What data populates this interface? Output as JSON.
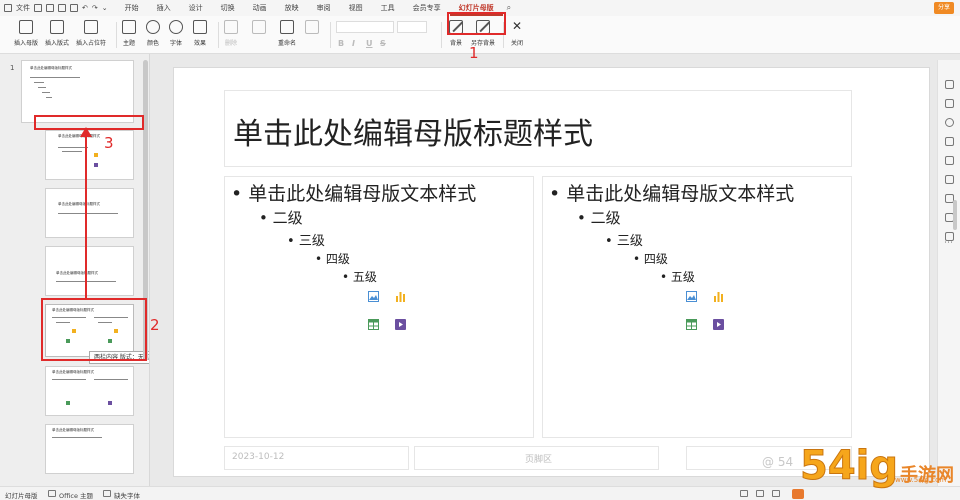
{
  "menubar": {
    "file": "文件",
    "start": "开始",
    "tabs": [
      "插入",
      "设计",
      "切换",
      "动画",
      "放映",
      "审阅",
      "视图",
      "工具",
      "会员专享",
      "幻灯片母版"
    ],
    "active_tab": "幻灯片母版",
    "share": "分享"
  },
  "ribbon": {
    "buttons": [
      "插入母版",
      "插入版式",
      "插入占位符",
      "主题",
      "颜色",
      "字体",
      "效果",
      "删除",
      "",
      "重命名",
      "",
      "",
      "背景",
      "另存背景",
      "关闭"
    ],
    "format_letters": [
      "B",
      "I",
      "U",
      "S"
    ]
  },
  "annotations": [
    "1",
    "2",
    "3"
  ],
  "thumbnails": {
    "first_number": "1",
    "titles": [
      "单击此处编辑母版标题样式",
      "单击此处编辑母版标题样式",
      "单击此处编辑母版标题样式",
      "单击此处编辑母版标题样式",
      "单击此处编辑母版标题样式",
      "单击此处编辑母版标题样式",
      "单击此处编辑母版标题样式"
    ],
    "tooltip": "两栏内容 版式：无幻灯片使用"
  },
  "slide": {
    "title": "单击此处编辑母版标题样式",
    "left": {
      "l1": "单击此处编辑母版文本样式",
      "l2": "二级",
      "l3": "三级",
      "l4": "四级",
      "l5": "五级"
    },
    "right": {
      "l1": "单击此处编辑母版文本样式",
      "l2": "二级",
      "l3": "三级",
      "l4": "四级",
      "l5": "五级"
    },
    "footer_date": "2023-10-12",
    "footer_text": "页脚区"
  },
  "statusbar": {
    "mode": "幻灯片母版",
    "theme": "Office 主题",
    "missing_font": "缺失字体"
  },
  "watermark": {
    "brand_num": "54ig",
    "brand_cn": "手游网",
    "url": "www.54ig.com",
    "faint": "@ 54"
  },
  "colors": {
    "annotation": "#e02a2a",
    "active_tab": "#c0392b",
    "share_button": "#f08a24"
  }
}
